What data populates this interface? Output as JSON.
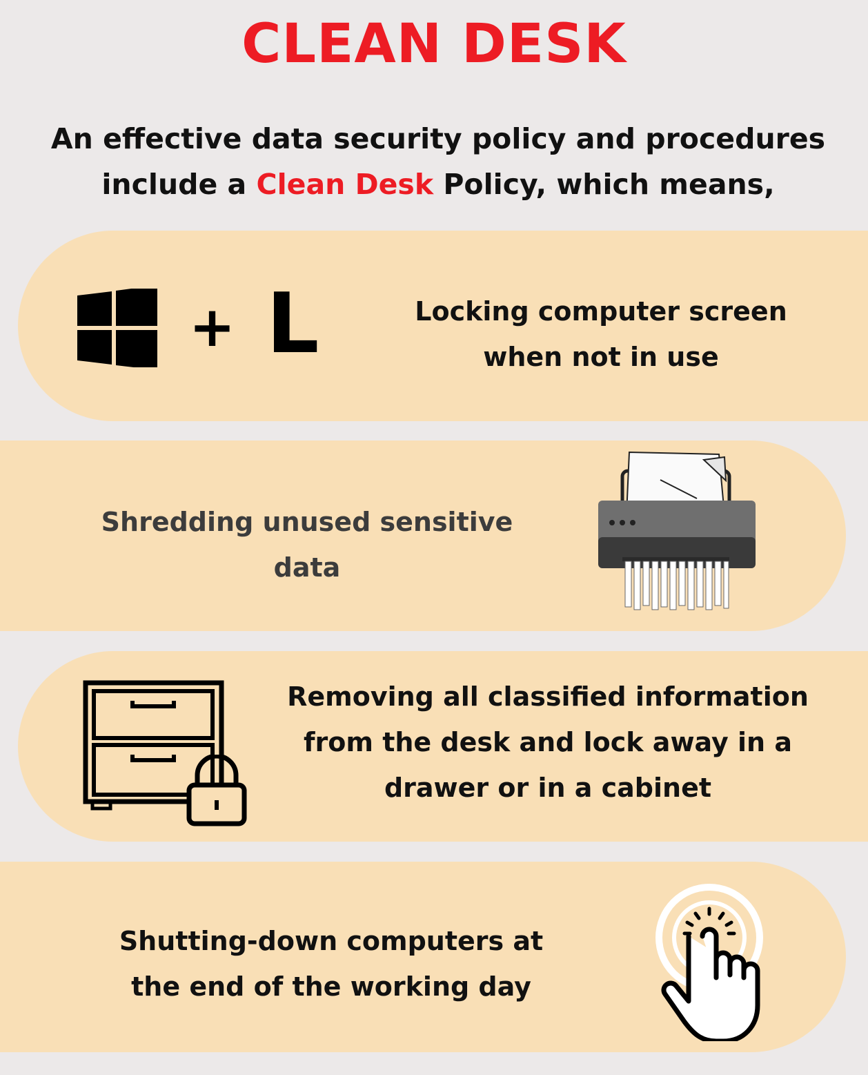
{
  "title": "CLEAN DESK",
  "intro": {
    "before": "An effective data security policy and procedures include a ",
    "highlight": "Clean Desk",
    "after": " Policy, which means,"
  },
  "items": [
    {
      "text_line1": "Locking computer screen",
      "text_line2": "when not in use",
      "key_plus": "+",
      "key_letter": "L",
      "icons": [
        "windows-logo-icon",
        "plus-icon",
        "letter-l-icon"
      ]
    },
    {
      "text_line1": "Shredding unused sensitive",
      "text_line2": "data",
      "icons": [
        "paper-shredder-icon"
      ]
    },
    {
      "text_line1": "Removing all classified information",
      "text_line2": "from the desk and lock away in a",
      "text_line3": "drawer or in a cabinet",
      "icons": [
        "cabinet-icon",
        "padlock-icon"
      ]
    },
    {
      "text_line1": "Shutting-down computers at",
      "text_line2": "the end of the working day",
      "icons": [
        "hand-click-icon"
      ]
    }
  ],
  "colors": {
    "accent": "#ed1c24",
    "band": "#f9dfb6",
    "background": "#ece9e9",
    "text": "#111111",
    "grey_text": "#3c3c3c"
  }
}
